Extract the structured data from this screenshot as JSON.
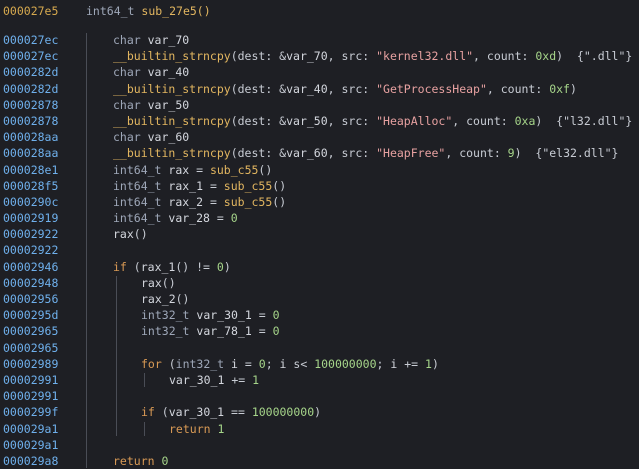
{
  "header": {
    "address": "000027e5",
    "signature_type": "int64_t",
    "signature_name": "sub_27e5()"
  },
  "lines": [
    {
      "addr": "000027ec",
      "indent": 0,
      "tokens": [
        [
          "type",
          "char "
        ],
        [
          "var",
          "var_70"
        ]
      ]
    },
    {
      "addr": "000027ec",
      "indent": 0,
      "tokens": [
        [
          "func",
          "__builtin_strncpy"
        ],
        [
          "punct",
          "(dest: &"
        ],
        [
          "var",
          "var_70"
        ],
        [
          "punct",
          ", src: "
        ],
        [
          "str",
          "\"kernel32.dll\""
        ],
        [
          "punct",
          ", count: "
        ],
        [
          "num",
          "0xd"
        ],
        [
          "punct",
          ")  "
        ],
        [
          "hint",
          "{\".dll\"}"
        ]
      ]
    },
    {
      "addr": "0000282d",
      "indent": 0,
      "tokens": [
        [
          "type",
          "char "
        ],
        [
          "var",
          "var_40"
        ]
      ]
    },
    {
      "addr": "0000282d",
      "indent": 0,
      "tokens": [
        [
          "func",
          "__builtin_strncpy"
        ],
        [
          "punct",
          "(dest: &"
        ],
        [
          "var",
          "var_40"
        ],
        [
          "punct",
          ", src: "
        ],
        [
          "str",
          "\"GetProcessHeap\""
        ],
        [
          "punct",
          ", count: "
        ],
        [
          "num",
          "0xf"
        ],
        [
          "punct",
          ")"
        ]
      ]
    },
    {
      "addr": "00002878",
      "indent": 0,
      "tokens": [
        [
          "type",
          "char "
        ],
        [
          "var",
          "var_50"
        ]
      ]
    },
    {
      "addr": "00002878",
      "indent": 0,
      "tokens": [
        [
          "func",
          "__builtin_strncpy"
        ],
        [
          "punct",
          "(dest: &"
        ],
        [
          "var",
          "var_50"
        ],
        [
          "punct",
          ", src: "
        ],
        [
          "str",
          "\"HeapAlloc\""
        ],
        [
          "punct",
          ", count: "
        ],
        [
          "num",
          "0xa"
        ],
        [
          "punct",
          ")  "
        ],
        [
          "hint",
          "{\"l32.dll\"}"
        ]
      ]
    },
    {
      "addr": "000028aa",
      "indent": 0,
      "tokens": [
        [
          "type",
          "char "
        ],
        [
          "var",
          "var_60"
        ]
      ]
    },
    {
      "addr": "000028aa",
      "indent": 0,
      "tokens": [
        [
          "func",
          "__builtin_strncpy"
        ],
        [
          "punct",
          "(dest: &"
        ],
        [
          "var",
          "var_60"
        ],
        [
          "punct",
          ", src: "
        ],
        [
          "str",
          "\"HeapFree\""
        ],
        [
          "punct",
          ", count: "
        ],
        [
          "num",
          "9"
        ],
        [
          "punct",
          ")  "
        ],
        [
          "hint",
          "{\"el32.dll\"}"
        ]
      ]
    },
    {
      "addr": "000028e1",
      "indent": 0,
      "tokens": [
        [
          "type",
          "int64_t "
        ],
        [
          "var",
          "rax"
        ],
        [
          "punct",
          " = "
        ],
        [
          "func",
          "sub_c55"
        ],
        [
          "punct",
          "()"
        ]
      ]
    },
    {
      "addr": "000028f5",
      "indent": 0,
      "tokens": [
        [
          "type",
          "int64_t "
        ],
        [
          "var",
          "rax_1"
        ],
        [
          "punct",
          " = "
        ],
        [
          "func",
          "sub_c55"
        ],
        [
          "punct",
          "()"
        ]
      ]
    },
    {
      "addr": "0000290c",
      "indent": 0,
      "tokens": [
        [
          "type",
          "int64_t "
        ],
        [
          "var",
          "rax_2"
        ],
        [
          "punct",
          " = "
        ],
        [
          "func",
          "sub_c55"
        ],
        [
          "punct",
          "()"
        ]
      ]
    },
    {
      "addr": "00002919",
      "indent": 0,
      "tokens": [
        [
          "type",
          "int64_t "
        ],
        [
          "var",
          "var_28"
        ],
        [
          "punct",
          " = "
        ],
        [
          "num",
          "0"
        ]
      ]
    },
    {
      "addr": "00002922",
      "indent": 0,
      "tokens": [
        [
          "var",
          "rax"
        ],
        [
          "punct",
          "()"
        ]
      ]
    },
    {
      "addr": "00002922",
      "indent": 0,
      "tokens": []
    },
    {
      "addr": "00002946",
      "indent": 0,
      "tokens": [
        [
          "kw",
          "if"
        ],
        [
          "punct",
          " ("
        ],
        [
          "var",
          "rax_1"
        ],
        [
          "punct",
          "() != "
        ],
        [
          "num",
          "0"
        ],
        [
          "punct",
          ")"
        ]
      ]
    },
    {
      "addr": "00002948",
      "indent": 1,
      "tokens": [
        [
          "var",
          "rax"
        ],
        [
          "punct",
          "()"
        ]
      ]
    },
    {
      "addr": "00002956",
      "indent": 1,
      "tokens": [
        [
          "var",
          "rax_2"
        ],
        [
          "punct",
          "()"
        ]
      ]
    },
    {
      "addr": "0000295d",
      "indent": 1,
      "tokens": [
        [
          "type",
          "int32_t "
        ],
        [
          "var",
          "var_30_1"
        ],
        [
          "punct",
          " = "
        ],
        [
          "num",
          "0"
        ]
      ]
    },
    {
      "addr": "00002965",
      "indent": 1,
      "tokens": [
        [
          "type",
          "int32_t "
        ],
        [
          "var",
          "var_78_1"
        ],
        [
          "punct",
          " = "
        ],
        [
          "num",
          "0"
        ]
      ]
    },
    {
      "addr": "00002965",
      "indent": 1,
      "tokens": []
    },
    {
      "addr": "00002989",
      "indent": 1,
      "tokens": [
        [
          "kw",
          "for"
        ],
        [
          "punct",
          " ("
        ],
        [
          "type",
          "int32_t "
        ],
        [
          "var",
          "i"
        ],
        [
          "punct",
          " = "
        ],
        [
          "num",
          "0"
        ],
        [
          "punct",
          "; "
        ],
        [
          "var",
          "i"
        ],
        [
          "punct",
          " s< "
        ],
        [
          "num",
          "100000000"
        ],
        [
          "punct",
          "; "
        ],
        [
          "var",
          "i"
        ],
        [
          "punct",
          " += "
        ],
        [
          "num",
          "1"
        ],
        [
          "punct",
          ")"
        ]
      ]
    },
    {
      "addr": "00002991",
      "indent": 2,
      "tokens": [
        [
          "var",
          "var_30_1"
        ],
        [
          "punct",
          " += "
        ],
        [
          "num",
          "1"
        ]
      ]
    },
    {
      "addr": "00002991",
      "indent": 1,
      "tokens": []
    },
    {
      "addr": "0000299f",
      "indent": 1,
      "tokens": [
        [
          "kw",
          "if"
        ],
        [
          "punct",
          " ("
        ],
        [
          "var",
          "var_30_1"
        ],
        [
          "punct",
          " == "
        ],
        [
          "num",
          "100000000"
        ],
        [
          "punct",
          ")"
        ]
      ]
    },
    {
      "addr": "000029a1",
      "indent": 2,
      "tokens": [
        [
          "kw",
          "return "
        ],
        [
          "num",
          "1"
        ]
      ]
    },
    {
      "addr": "000029a1",
      "indent": 0,
      "tokens": []
    },
    {
      "addr": "000029a8",
      "indent": 0,
      "tokens": [
        [
          "kw",
          "return "
        ],
        [
          "num",
          "0"
        ]
      ]
    }
  ]
}
